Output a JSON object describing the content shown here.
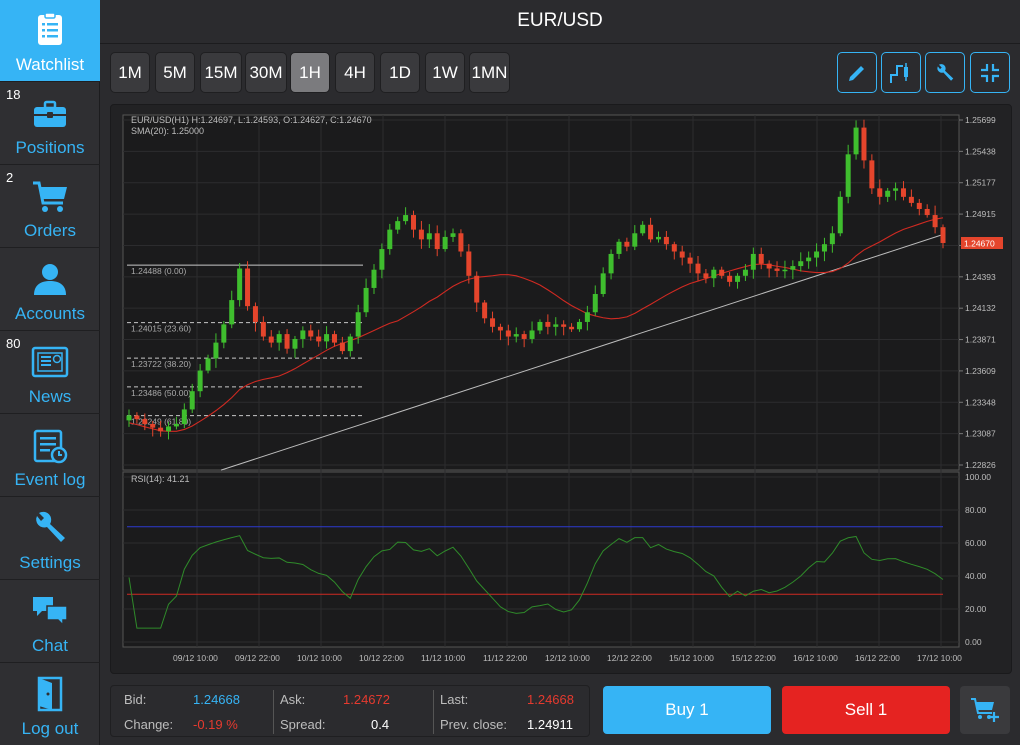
{
  "app": {
    "title": "EUR/USD"
  },
  "sidebar": {
    "items": [
      {
        "label": "Watchlist",
        "icon": "watchlist-icon",
        "badge": ""
      },
      {
        "label": "Positions",
        "icon": "briefcase-icon",
        "badge": "18"
      },
      {
        "label": "Orders",
        "icon": "cart-icon",
        "badge": "2"
      },
      {
        "label": "Accounts",
        "icon": "user-icon",
        "badge": ""
      },
      {
        "label": "News",
        "icon": "news-icon",
        "badge": "80"
      },
      {
        "label": "Event log",
        "icon": "event-log-icon",
        "badge": ""
      },
      {
        "label": "Settings",
        "icon": "wrench-icon",
        "badge": ""
      },
      {
        "label": "Chat",
        "icon": "chat-icon",
        "badge": ""
      },
      {
        "label": "Log out",
        "icon": "logout-icon",
        "badge": ""
      }
    ]
  },
  "toolbar": {
    "timeframes": [
      "1M",
      "5M",
      "15M",
      "30M",
      "1H",
      "4H",
      "1D",
      "1W",
      "1MN"
    ],
    "active_timeframe": "1H",
    "tools": [
      "pencil-icon",
      "indicator-icon",
      "wrench-icon",
      "collapse-icon"
    ]
  },
  "chart_data": {
    "type": "candlestick",
    "symbol_info": "EUR/USD(H1) H:1.24697, L:1.24593, O:1.24627, C:1.24670",
    "sma_label": "SMA(20): 1.25000",
    "rsi_label": "RSI(14): 41.21",
    "price_ticks": [
      "1.25699",
      "1.25438",
      "1.25177",
      "1.24915",
      "1.24654",
      "1.24393",
      "1.24132",
      "1.23871",
      "1.23609",
      "1.23348",
      "1.23087",
      "1.22826"
    ],
    "ylim": [
      1.22826,
      1.25699
    ],
    "current_price": "1.24670",
    "rsi_ticks": [
      "100.00",
      "80.00",
      "60.00",
      "40.00",
      "20.00",
      "0.00"
    ],
    "rsi_levels": [
      70,
      30
    ],
    "x_ticks": [
      "09/12 10:00",
      "09/12 22:00",
      "10/12 10:00",
      "10/12 22:00",
      "11/12 10:00",
      "11/12 22:00",
      "12/12 10:00",
      "12/12 22:00",
      "15/12 10:00",
      "15/12 22:00",
      "16/12 10:00",
      "16/12 22:00",
      "17/12 10:00"
    ],
    "fib_levels": [
      {
        "price": 1.24488,
        "label": "1.24488 (0.00)"
      },
      {
        "price": 1.24015,
        "label": "1.24015 (23.60)"
      },
      {
        "price": 1.23722,
        "label": "1.23722 (38.20)"
      },
      {
        "price": 1.23486,
        "label": "1.23486 (50.00)"
      },
      {
        "price": 1.23249,
        "label": "1.23249 (61.80)"
      }
    ],
    "trendline": {
      "from_price": 1.228,
      "to_price": 1.2474
    },
    "close_path": [
      1.2325,
      1.2322,
      1.2318,
      1.2315,
      1.2312,
      1.2316,
      1.2318,
      1.233,
      1.2345,
      1.2362,
      1.2372,
      1.2385,
      1.24,
      1.242,
      1.2446,
      1.2415,
      1.2402,
      1.239,
      1.2385,
      1.2392,
      1.238,
      1.2388,
      1.2395,
      1.239,
      1.2386,
      1.2392,
      1.2385,
      1.2378,
      1.239,
      1.241,
      1.243,
      1.2445,
      1.2462,
      1.2478,
      1.2485,
      1.249,
      1.2478,
      1.247,
      1.2475,
      1.2462,
      1.2472,
      1.2475,
      1.246,
      1.244,
      1.2418,
      1.2405,
      1.2398,
      1.2395,
      1.239,
      1.2392,
      1.2388,
      1.2395,
      1.2402,
      1.2398,
      1.24,
      1.2398,
      1.2396,
      1.2402,
      1.241,
      1.2425,
      1.2442,
      1.2458,
      1.2468,
      1.2464,
      1.2475,
      1.2482,
      1.247,
      1.2472,
      1.2466,
      1.246,
      1.2455,
      1.245,
      1.2442,
      1.2438,
      1.2445,
      1.244,
      1.2435,
      1.244,
      1.2445,
      1.2458,
      1.245,
      1.2446,
      1.2444,
      1.2445,
      1.2448,
      1.2452,
      1.2455,
      1.246,
      1.2466,
      1.2475,
      1.2505,
      1.254,
      1.2562,
      1.2535,
      1.2512,
      1.2505,
      1.251,
      1.2512,
      1.2505,
      1.25,
      1.2495,
      1.249,
      1.248,
      1.2467
    ]
  },
  "quote": {
    "bid_label": "Bid:",
    "bid": "1.24668",
    "ask_label": "Ask:",
    "ask": "1.24672",
    "last_label": "Last:",
    "last": "1.24668",
    "change_label": "Change:",
    "change": "-0.19 %",
    "spread_label": "Spread:",
    "spread": "0.4",
    "prev_close_label": "Prev. close:",
    "prev_close": "1.24911"
  },
  "actions": {
    "buy_label": "Buy 1",
    "sell_label": "Sell 1"
  },
  "colors": {
    "accent": "#36b4f5",
    "bull": "#3fbe2e",
    "bear": "#e5452c",
    "sell": "#e52321"
  }
}
